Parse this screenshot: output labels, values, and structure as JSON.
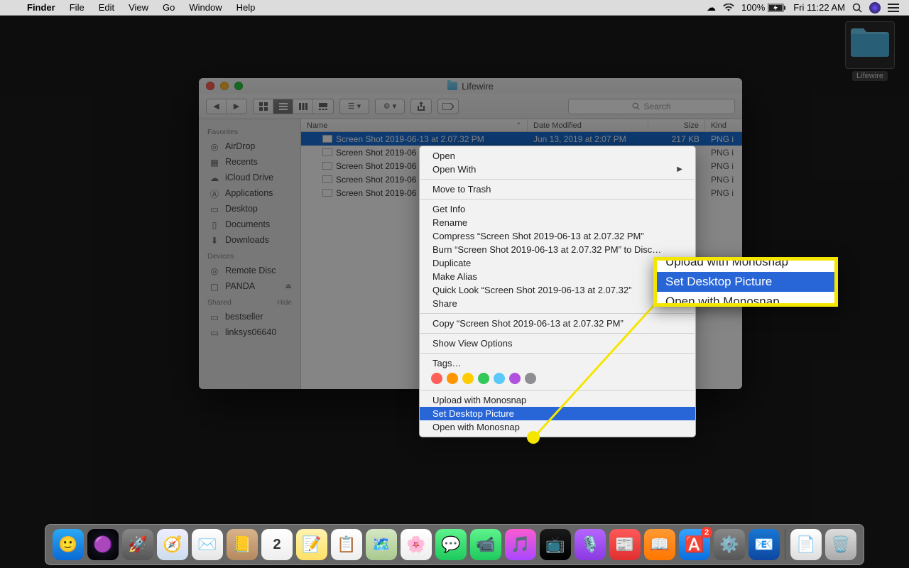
{
  "menubar": {
    "app": "Finder",
    "items": [
      "File",
      "Edit",
      "View",
      "Go",
      "Window",
      "Help"
    ],
    "status": {
      "battery": "100%",
      "time": "Fri 11:22 AM"
    }
  },
  "desktop": {
    "folder_name": "Lifewire"
  },
  "finder": {
    "title": "Lifewire",
    "search_placeholder": "Search",
    "sidebar": {
      "favorites_header": "Favorites",
      "favorites": [
        "AirDrop",
        "Recents",
        "iCloud Drive",
        "Applications",
        "Desktop",
        "Documents",
        "Downloads"
      ],
      "devices_header": "Devices",
      "devices": [
        "Remote Disc",
        "PANDA"
      ],
      "shared_header": "Shared",
      "shared_hide": "Hide",
      "shared": [
        "bestseller",
        "linksys06640"
      ]
    },
    "columns": {
      "name": "Name",
      "date": "Date Modified",
      "size": "Size",
      "kind": "Kind"
    },
    "rows": [
      {
        "name": "Screen Shot 2019-06-13 at 2.07.32 PM",
        "date": "Jun 13, 2019 at 2:07 PM",
        "size": "217 KB",
        "kind": "PNG i"
      },
      {
        "name": "Screen Shot 2019-06",
        "date": "",
        "size": "",
        "kind": "PNG i"
      },
      {
        "name": "Screen Shot 2019-06",
        "date": "",
        "size": "",
        "kind": "PNG i"
      },
      {
        "name": "Screen Shot 2019-06",
        "date": "",
        "size": "",
        "kind": "PNG i"
      },
      {
        "name": "Screen Shot 2019-06",
        "date": "",
        "size": "",
        "kind": "PNG i"
      }
    ]
  },
  "context_menu": {
    "groups": [
      [
        "Open",
        "Open With"
      ],
      [
        "Move to Trash"
      ],
      [
        "Get Info",
        "Rename",
        "Compress “Screen Shot 2019-06-13 at 2.07.32 PM”",
        "Burn “Screen Shot 2019-06-13 at 2.07.32 PM” to Disc…",
        "Duplicate",
        "Make Alias",
        "Quick Look “Screen Shot 2019-06-13 at 2.07.32”",
        "Share"
      ],
      [
        "Copy “Screen Shot 2019-06-13 at 2.07.32 PM”"
      ],
      [
        "Show View Options"
      ],
      [
        "Tags…"
      ],
      [
        "Upload with Monosnap",
        "Set Desktop Picture",
        "Open with Monosnap"
      ]
    ],
    "submenu_item": "Open With",
    "highlighted": "Set Desktop Picture",
    "tag_colors": [
      "#ff5f57",
      "#ff9500",
      "#ffcc00",
      "#34c759",
      "#5ac8fa",
      "#af52de",
      "#8e8e93"
    ]
  },
  "callout": {
    "lines": [
      "Upload with Monosnap",
      "Set Desktop Picture",
      "Open with Monosnap"
    ],
    "highlight_index": 1
  },
  "dock": {
    "apps": [
      {
        "name": "finder",
        "color": "linear-gradient(#2aa8f6,#0a6ad4)",
        "emoji": "🙂"
      },
      {
        "name": "siri",
        "color": "radial-gradient(circle,#1a1a2e,#000)",
        "emoji": "🟣"
      },
      {
        "name": "launchpad",
        "color": "linear-gradient(#888,#555)",
        "emoji": "🚀"
      },
      {
        "name": "safari",
        "color": "linear-gradient(#eef,#cde)",
        "emoji": "🧭"
      },
      {
        "name": "mail",
        "color": "linear-gradient(#fff,#e6e6e6)",
        "emoji": "✉️"
      },
      {
        "name": "contacts",
        "color": "linear-gradient(#d9b38c,#b5895e)",
        "emoji": "📒"
      },
      {
        "name": "calendar",
        "color": "linear-gradient(#fff,#eee)",
        "emoji": "📅",
        "text": "2"
      },
      {
        "name": "notes",
        "color": "linear-gradient(#fff3b0,#ffe066)",
        "emoji": "📝"
      },
      {
        "name": "reminders",
        "color": "linear-gradient(#fff,#eee)",
        "emoji": "📋"
      },
      {
        "name": "maps",
        "color": "linear-gradient(#d5e8c4,#a8c98e)",
        "emoji": "🗺️"
      },
      {
        "name": "photos",
        "color": "linear-gradient(#fff,#eee)",
        "emoji": "🌸"
      },
      {
        "name": "messages",
        "color": "linear-gradient(#5ef38c,#1ec95c)",
        "emoji": "💬"
      },
      {
        "name": "facetime",
        "color": "linear-gradient(#5ef38c,#1ec95c)",
        "emoji": "📹"
      },
      {
        "name": "itunes",
        "color": "linear-gradient(#fb5bd0,#a947ff)",
        "emoji": "🎵"
      },
      {
        "name": "tv",
        "color": "linear-gradient(#1a1a1a,#000)",
        "emoji": "📺"
      },
      {
        "name": "podcasts",
        "color": "linear-gradient(#b565ff,#8a3ae0)",
        "emoji": "🎙️"
      },
      {
        "name": "news",
        "color": "linear-gradient(#ff5858,#e03030)",
        "emoji": "📰"
      },
      {
        "name": "books",
        "color": "linear-gradient(#ff9933,#ff7700)",
        "emoji": "📖"
      },
      {
        "name": "appstore",
        "color": "linear-gradient(#36a3ff,#0a6ee0)",
        "emoji": "🅰️",
        "badge": "2"
      },
      {
        "name": "preferences",
        "color": "linear-gradient(#888,#555)",
        "emoji": "⚙️"
      },
      {
        "name": "outlook",
        "color": "linear-gradient(#1976d2,#0d47a1)",
        "emoji": "📧"
      },
      {
        "name": "divider"
      },
      {
        "name": "xlsx",
        "color": "linear-gradient(#fff,#ddd)",
        "emoji": "📄"
      },
      {
        "name": "trash",
        "color": "linear-gradient(#ddd,#aaa)",
        "emoji": "🗑️"
      }
    ]
  }
}
